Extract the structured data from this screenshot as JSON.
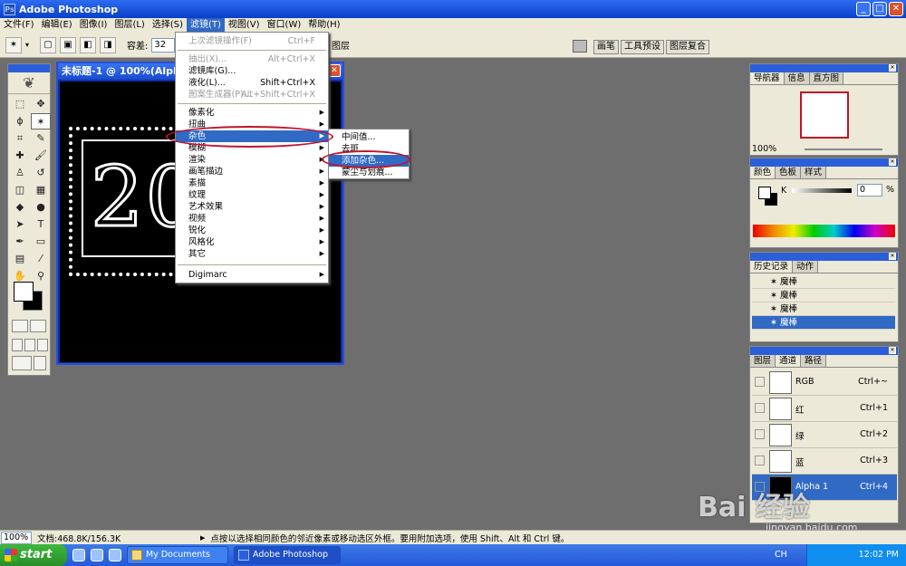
{
  "app": {
    "title": "Adobe Photoshop"
  },
  "menubar": [
    "文件(F)",
    "编辑(E)",
    "图像(I)",
    "图层(L)",
    "选择(S)",
    "滤镜(T)",
    "视图(V)",
    "窗口(W)",
    "帮助(H)"
  ],
  "options": {
    "tolerance_label": "容差:",
    "tolerance_value": "32",
    "layer_label": "图层"
  },
  "palette_well": [
    "画笔",
    "工具预设",
    "图层复合"
  ],
  "document": {
    "title": "未标题-1 @ 100%(Alpha 1)",
    "stamp_text": "20"
  },
  "filter_menu": {
    "items": [
      {
        "label": "上次滤镜操作(F)",
        "shortcut": "Ctrl+F",
        "disabled": true
      },
      {
        "label": "抽出(X)...",
        "shortcut": "Alt+Ctrl+X",
        "disabled": true
      },
      {
        "label": "滤镜库(G)...",
        "shortcut": "",
        "disabled": false
      },
      {
        "label": "液化(L)...",
        "shortcut": "Shift+Ctrl+X",
        "disabled": false
      },
      {
        "label": "图案生成器(P)...",
        "shortcut": "Alt+Shift+Ctrl+X",
        "disabled": true
      },
      {
        "label": "像素化"
      },
      {
        "label": "扭曲"
      },
      {
        "label": "杂色",
        "highlighted": true
      },
      {
        "label": "模糊"
      },
      {
        "label": "渲染"
      },
      {
        "label": "画笔描边"
      },
      {
        "label": "素描"
      },
      {
        "label": "纹理"
      },
      {
        "label": "艺术效果"
      },
      {
        "label": "视频"
      },
      {
        "label": "锐化"
      },
      {
        "label": "风格化"
      },
      {
        "label": "其它"
      },
      {
        "label": "Digimarc"
      }
    ]
  },
  "noise_submenu": [
    "中间值...",
    "去斑",
    "添加杂色...",
    "蒙尘与划痕..."
  ],
  "navigator_panel": {
    "tabs": [
      "导航器",
      "信息",
      "直方图"
    ],
    "zoom": "100%"
  },
  "color_panel": {
    "tabs": [
      "颜色",
      "色板",
      "样式"
    ],
    "channel": "K",
    "value": "0",
    "unit": "%"
  },
  "history_panel": {
    "tabs": [
      "历史记录",
      "动作"
    ],
    "items": [
      "魔棒",
      "魔棒",
      "魔棒",
      "魔棒"
    ]
  },
  "channels_panel": {
    "tabs": [
      "图层",
      "通道",
      "路径"
    ],
    "rows": [
      {
        "name": "RGB",
        "shortcut": "Ctrl+~"
      },
      {
        "name": "红",
        "shortcut": "Ctrl+1"
      },
      {
        "name": "绿",
        "shortcut": "Ctrl+2"
      },
      {
        "name": "蓝",
        "shortcut": "Ctrl+3"
      },
      {
        "name": "Alpha 1",
        "shortcut": "Ctrl+4"
      }
    ]
  },
  "status": {
    "zoom": "100%",
    "doc_size": "文档:468.8K/156.3K",
    "hint": "点按以选择相同颜色的邻近像素或移动选区外框。要用附加选项，使用 Shift、Alt 和 Ctrl 键。"
  },
  "taskbar": {
    "start": "start",
    "tasks": [
      "My Documents",
      "Adobe Photoshop"
    ],
    "lang": "CH",
    "clock": "12:02 PM"
  },
  "watermark": {
    "brand": "Bai 经验",
    "url": "jingyan.baidu.com"
  }
}
